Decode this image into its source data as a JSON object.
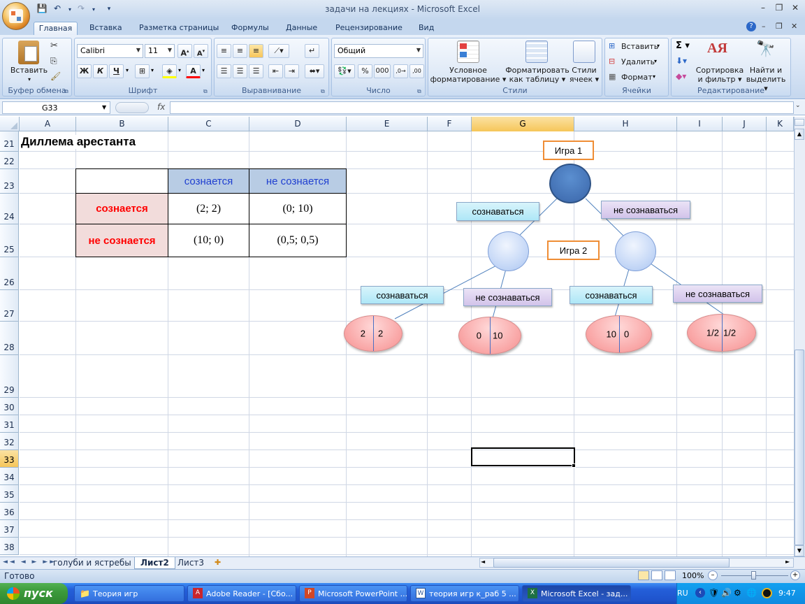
{
  "window": {
    "title": "задачи на лекциях - Microsoft Excel"
  },
  "ribbon": {
    "tabs": [
      "Главная",
      "Вставка",
      "Разметка страницы",
      "Формулы",
      "Данные",
      "Рецензирование",
      "Вид"
    ],
    "active_tab": "Главная",
    "groups": {
      "clipboard": {
        "label": "Буфер обмена",
        "paste": "Вставить"
      },
      "font": {
        "label": "Шрифт",
        "font_name": "Calibri",
        "font_size": "11",
        "bold": "Ж",
        "italic": "К",
        "underline": "Ч"
      },
      "alignment": {
        "label": "Выравнивание"
      },
      "number": {
        "label": "Число",
        "format": "Общий",
        "percent": "%",
        "thousands": "000"
      },
      "styles": {
        "label": "Стили",
        "conditional": [
          "Условное",
          "форматирование ▾"
        ],
        "format_table": [
          "Форматировать",
          "как таблицу ▾"
        ],
        "cell_styles": [
          "Стили",
          "ячеек ▾"
        ]
      },
      "cells": {
        "label": "Ячейки",
        "insert": "Вставить",
        "delete": "Удалить",
        "format": "Формат"
      },
      "editing": {
        "label": "Редактирование",
        "sort": [
          "Сортировка",
          "и фильтр ▾"
        ],
        "find": [
          "Найти и",
          "выделить ▾"
        ]
      }
    }
  },
  "formula_bar": {
    "name_box": "G33",
    "fx": "fx",
    "content": ""
  },
  "grid": {
    "columns": [
      "A",
      "B",
      "C",
      "D",
      "E",
      "F",
      "G",
      "H",
      "I",
      "J",
      "K"
    ],
    "selected_column": "G",
    "rows": [
      "21",
      "22",
      "23",
      "24",
      "25",
      "26",
      "27",
      "28",
      "29",
      "30",
      "31",
      "32",
      "33",
      "34",
      "35",
      "36",
      "37",
      "38"
    ],
    "selected_row": "33",
    "selected_cell": "G33"
  },
  "sheet": {
    "title": "Диллема арестанта",
    "table": {
      "col_headers": [
        "сознается",
        "не сознается"
      ],
      "row_headers": [
        "сознается",
        "не сознается"
      ],
      "values": [
        [
          "(2; 2)",
          "(0; 10)"
        ],
        [
          "(10; 0)",
          "(0,5; 0,5)"
        ]
      ]
    },
    "tree": {
      "game1": "Игра 1",
      "game2": "Игра 2",
      "branch_labels": {
        "top_left": "сознаваться",
        "top_right": "не сознаваться",
        "l_left": "сознаваться",
        "l_right": "не сознаваться",
        "r_left": "сознаваться",
        "r_right": "не сознаваться"
      },
      "leaves": [
        [
          "2",
          "2"
        ],
        [
          "0",
          "10"
        ],
        [
          "10",
          "0"
        ],
        [
          "1/2",
          "1/2"
        ]
      ]
    }
  },
  "sheet_tabs": [
    "голуби и ястребы",
    "Лист2",
    "Лист3"
  ],
  "active_sheet": "Лист2",
  "status": {
    "text": "Готово",
    "zoom": "100%"
  },
  "taskbar": {
    "start": "пуск",
    "items": [
      "Теория игр",
      "Adobe Reader - [Сбо...",
      "Microsoft PowerPoint ...",
      "теория игр к_раб 5 ...",
      "Microsoft Excel - зад..."
    ],
    "lang": "RU",
    "clock": "9:47"
  }
}
